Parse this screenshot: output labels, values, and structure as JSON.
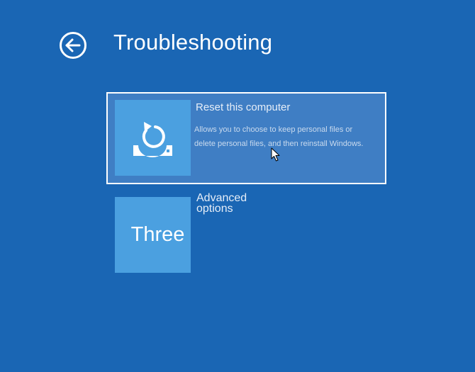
{
  "header": {
    "back_icon": "back-arrow-circle-icon",
    "title": "Troubleshooting"
  },
  "options": [
    {
      "id": "reset",
      "title": "Reset this computer",
      "description": "Allows you to choose to keep personal files or delete personal files, and then reinstall Windows.",
      "icon": "reset-refresh-icon",
      "selected": true
    },
    {
      "id": "advanced",
      "title": "Advanced options",
      "tile_text": "Three",
      "selected": false
    }
  ],
  "colors": {
    "background": "#1a66b4",
    "tile": "#4ba0e0",
    "selected_fill": "#3f7ec4",
    "selected_border": "#ffffff"
  },
  "pointer": "arrow-cursor-icon"
}
